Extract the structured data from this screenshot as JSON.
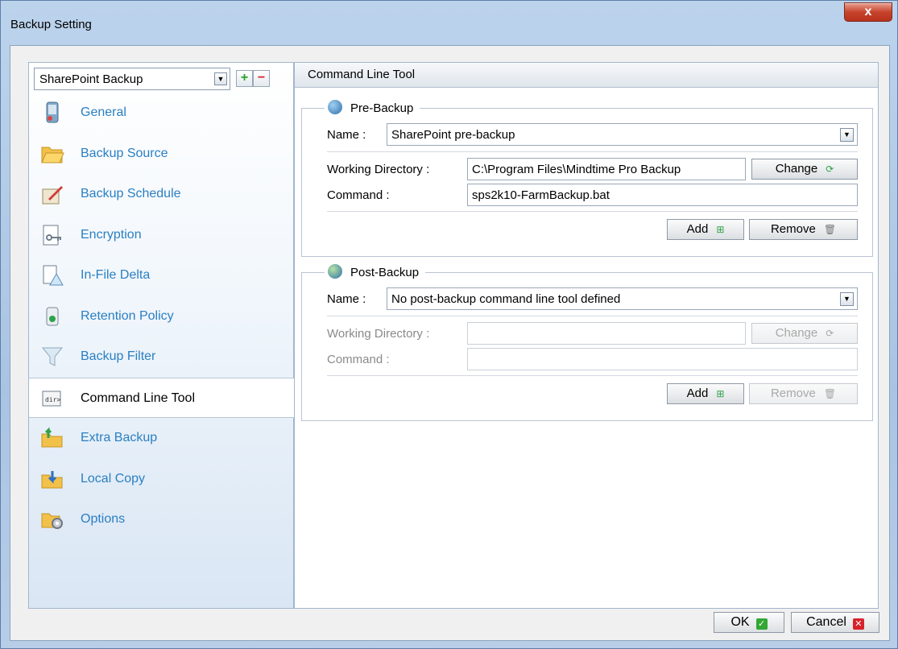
{
  "window": {
    "title": "Backup Setting",
    "close_label": "x"
  },
  "profile": {
    "selected": "SharePoint Backup",
    "add_label": "+",
    "remove_label": "−"
  },
  "sidebar": {
    "items": [
      {
        "label": "General",
        "icon": "general-icon"
      },
      {
        "label": "Backup Source",
        "icon": "folder-icon"
      },
      {
        "label": "Backup Schedule",
        "icon": "schedule-icon"
      },
      {
        "label": "Encryption",
        "icon": "encryption-icon"
      },
      {
        "label": "In-File Delta",
        "icon": "delta-icon"
      },
      {
        "label": "Retention Policy",
        "icon": "recycle-bin-icon"
      },
      {
        "label": "Backup Filter",
        "icon": "funnel-icon"
      },
      {
        "label": "Command Line Tool",
        "icon": "cmd-icon"
      },
      {
        "label": "Extra Backup",
        "icon": "extra-backup-icon"
      },
      {
        "label": "Local Copy",
        "icon": "local-copy-icon"
      },
      {
        "label": "Options",
        "icon": "options-icon"
      }
    ],
    "active_index": 7
  },
  "main": {
    "header": "Command Line Tool",
    "pre": {
      "legend": "Pre-Backup",
      "name_label": "Name :",
      "name_value": "SharePoint pre-backup",
      "wd_label": "Working Directory :",
      "wd_value": "C:\\Program Files\\Mindtime Pro Backup",
      "change_label": "Change",
      "cmd_label": "Command :",
      "cmd_value": "sps2k10-FarmBackup.bat",
      "add_label": "Add",
      "remove_label": "Remove"
    },
    "post": {
      "legend": "Post-Backup",
      "name_label": "Name :",
      "name_value": "No post-backup command line tool defined",
      "wd_label": "Working Directory :",
      "wd_value": "",
      "change_label": "Change",
      "cmd_label": "Command :",
      "cmd_value": "",
      "add_label": "Add",
      "remove_label": "Remove"
    }
  },
  "footer": {
    "ok_label": "OK",
    "cancel_label": "Cancel"
  },
  "colors": {
    "accent_link": "#2a7fc2",
    "ok_green": "#33a733",
    "cancel_red": "#d8222b"
  }
}
